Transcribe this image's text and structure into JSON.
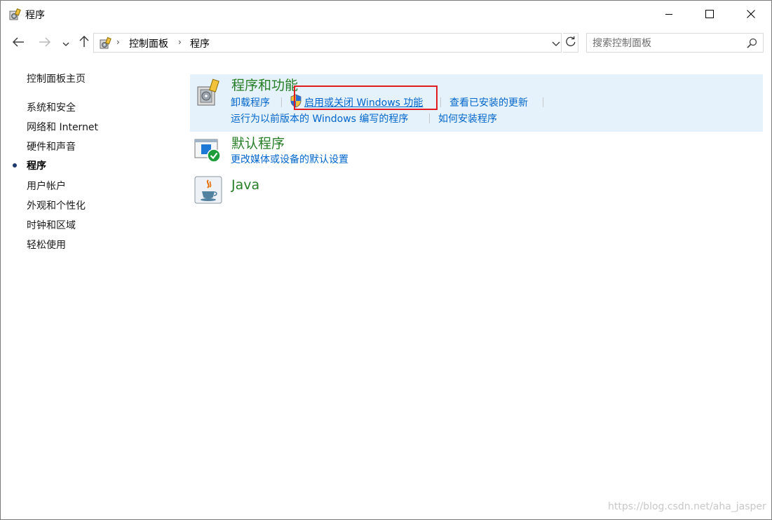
{
  "window": {
    "title": "程序",
    "icon": "control-panel-programs-icon"
  },
  "titlebar_buttons": {
    "minimize": "minimize-icon",
    "maximize": "maximize-icon",
    "close": "close-icon"
  },
  "address": {
    "crumbs": [
      "控制面板",
      "程序"
    ],
    "search_placeholder": "搜索控制面板"
  },
  "sidebar": {
    "items": [
      {
        "label": "控制面板主页",
        "active": false
      },
      {
        "label": "系统和安全",
        "active": false
      },
      {
        "label": "网络和 Internet",
        "active": false
      },
      {
        "label": "硬件和声音",
        "active": false
      },
      {
        "label": "程序",
        "active": true
      },
      {
        "label": "用户帐户",
        "active": false
      },
      {
        "label": "外观和个性化",
        "active": false
      },
      {
        "label": "时钟和区域",
        "active": false
      },
      {
        "label": "轻松使用",
        "active": false
      }
    ]
  },
  "categories": [
    {
      "title": "程序和功能",
      "icon": "programs-features-icon",
      "links": [
        "卸载程序",
        "启用或关闭 Windows 功能",
        "查看已安装的更新",
        "运行为以前版本的 Windows 编写的程序",
        "如何安装程序"
      ]
    },
    {
      "title": "默认程序",
      "icon": "default-programs-icon",
      "links": [
        "更改媒体或设备的默认设置"
      ]
    },
    {
      "title": "Java",
      "icon": "java-icon",
      "links": []
    }
  ],
  "colors": {
    "category_title": "#267e26",
    "link": "#0066cc",
    "highlight_bg": "#e5f1fb",
    "annotation_box": "#e11b22"
  },
  "watermark": "https://blog.csdn.net/aha_jasper"
}
